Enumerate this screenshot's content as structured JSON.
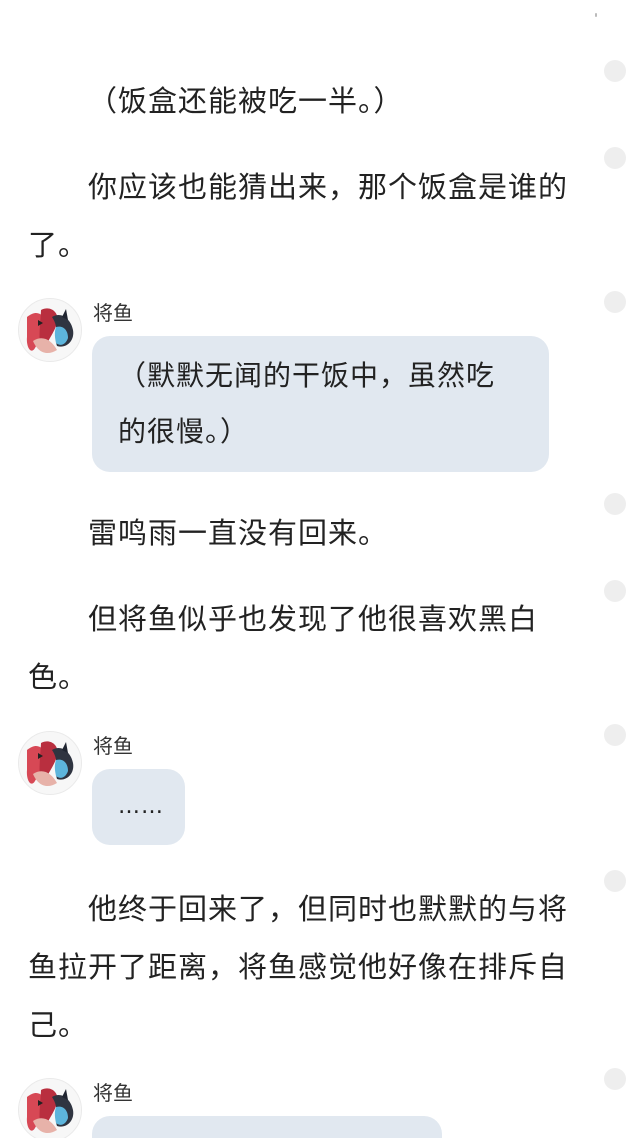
{
  "paragraphs": [
    "（饭盒还能被吃一半。）",
    "你应该也能猜出来，那个饭盒是谁的了。",
    "雷鸣雨一直没有回来。",
    "但将鱼似乎也发现了他很喜欢黑白色。",
    "他终于回来了，但同时也默默的与将鱼拉开了距离，将鱼感觉他好像在排斥自己。"
  ],
  "chats": [
    {
      "name": "将鱼",
      "message": "（默默无闻的干饭中，虽然吃的很慢。）"
    },
    {
      "name": "将鱼",
      "message": "……"
    },
    {
      "name": "将鱼",
      "message": ""
    }
  ],
  "colors": {
    "bubble": "#e1e8f0",
    "text": "#222222",
    "side_dot": "#eeeeee"
  }
}
